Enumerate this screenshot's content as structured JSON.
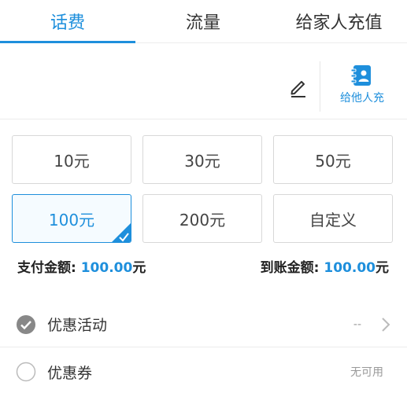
{
  "tabs": [
    {
      "label": "话费",
      "active": true
    },
    {
      "label": "流量",
      "active": false
    },
    {
      "label": "给家人充值",
      "active": false
    }
  ],
  "phone": {
    "value": "",
    "placeholder": ""
  },
  "recharge_other": {
    "label": "给他人充"
  },
  "amounts": [
    {
      "label": "10元",
      "selected": false
    },
    {
      "label": "30元",
      "selected": false
    },
    {
      "label": "50元",
      "selected": false
    },
    {
      "label": "100元",
      "selected": true
    },
    {
      "label": "200元",
      "selected": false
    },
    {
      "label": "自定义",
      "selected": false
    }
  ],
  "summary": {
    "pay_label": "支付金额: ",
    "pay_value": "100.00",
    "pay_unit": "元",
    "receive_label": "到账金额: ",
    "receive_value": "100.00",
    "receive_unit": "元"
  },
  "promotions": {
    "label": "优惠活动",
    "value": "--",
    "checked": true
  },
  "coupon": {
    "label": "优惠券",
    "value": "无可用",
    "checked": false
  },
  "colors": {
    "accent": "#1e8fdc",
    "muted": "#999999",
    "check_gray": "#888888"
  }
}
